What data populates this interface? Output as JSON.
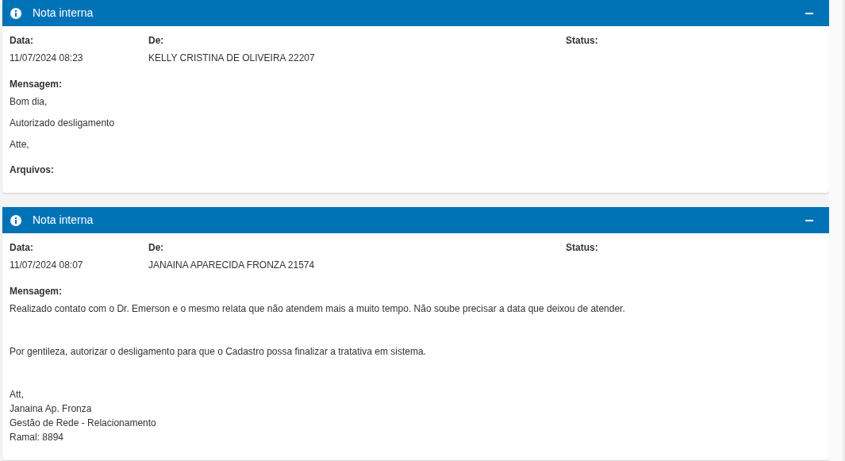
{
  "panels": [
    {
      "title": "Nota interna",
      "expanded": true,
      "fields": [
        {
          "label": "Data:",
          "value": "11/07/2024 08:23"
        },
        {
          "label": "De:",
          "value": "KELLY CRISTINA DE OLIVEIRA 22207"
        },
        {
          "label": "Status:"
        }
      ],
      "message": {
        "label": "Mensagem:",
        "kind": "compact",
        "paragraphs": [
          [
            "Bom dia,"
          ],
          [
            "Autorizado desligamento"
          ],
          [
            "Atte,"
          ]
        ]
      },
      "files_label": "Arquivos:"
    },
    {
      "title": "Nota interna",
      "expanded": true,
      "fields": [
        {
          "label": "Data:",
          "value": "11/07/2024 08:07"
        },
        {
          "label": "De:",
          "value": "JANAINA APARECIDA FRONZA 21574"
        },
        {
          "label": "Status:"
        }
      ],
      "message": {
        "label": "Mensagem:",
        "kind": "spaced",
        "paragraphs": [
          [
            "Realizado contato com o Dr. Emerson e o mesmo relata que não atendem mais a muito tempo. Não soube precisar a data que deixou de atender."
          ],
          [
            "Por gentileza, autorizar o desligamento para que o Cadastro possa finalizar a tratativa em sistema."
          ],
          [
            "Att,",
            "Janaina Ap. Fronza",
            "Gestão de Rede - Relacionamento",
            "Ramal: 8894"
          ]
        ]
      }
    }
  ]
}
